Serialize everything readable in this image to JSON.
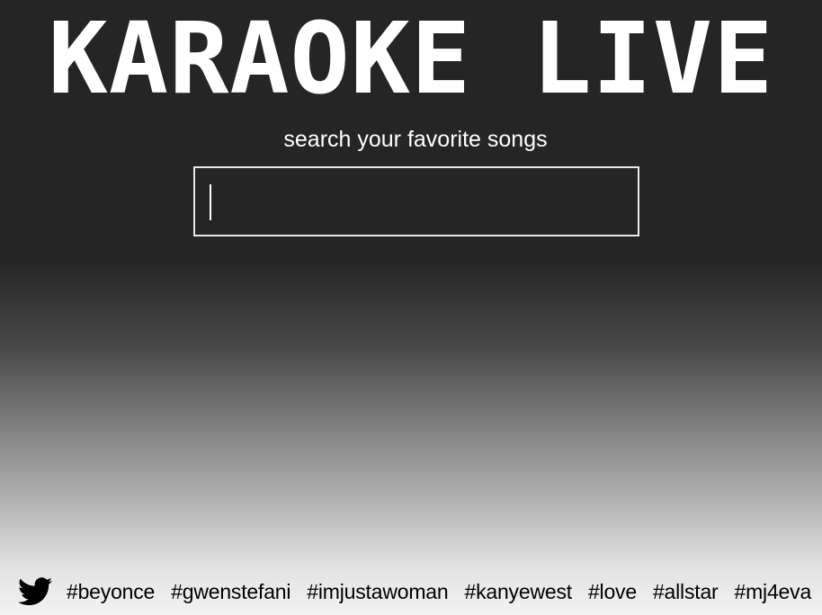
{
  "header": {
    "title": "KARAOKE LIVE",
    "subtitle": "search your favorite songs"
  },
  "search": {
    "value": "",
    "placeholder": ""
  },
  "footer": {
    "icon": "twitter-bird-icon",
    "hashtags": [
      "#beyonce",
      "#gwenstefani",
      "#imjustawoman",
      "#kanyewest",
      "#love",
      "#allstar",
      "#mj4eva"
    ]
  },
  "colors": {
    "background_top": "#262525",
    "background_bottom": "#f3f3f3",
    "title_text": "#ffffff",
    "hashtag_text": "#000000",
    "search_border": "#e8e8e8"
  }
}
